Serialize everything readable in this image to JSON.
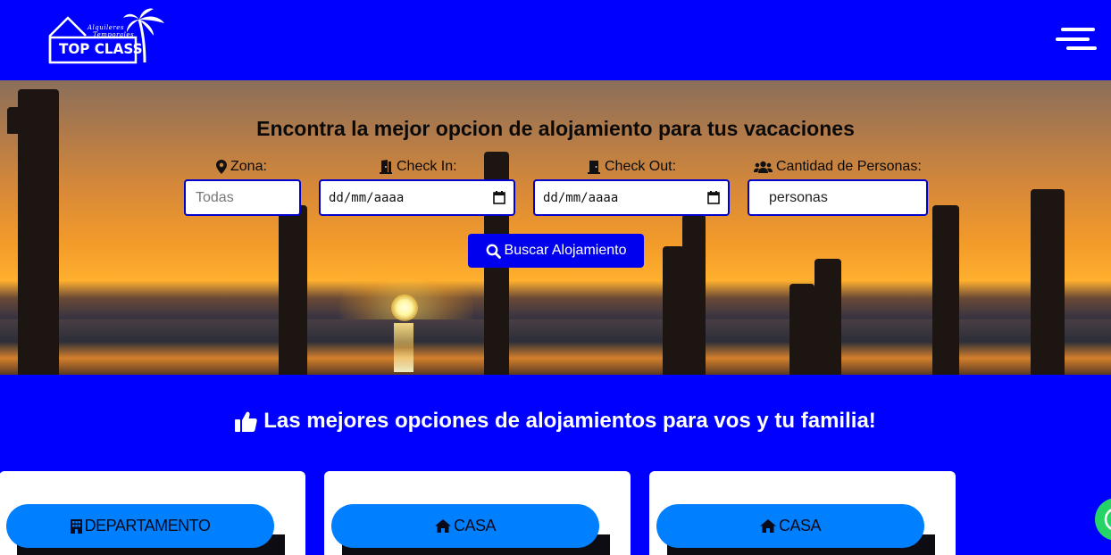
{
  "header": {
    "logo": {
      "line1": "Alquileres",
      "line2": "Temporales",
      "brand": "TOP CLASS"
    }
  },
  "search": {
    "title": "Encontra la mejor opcion de alojamiento para tus vacaciones",
    "zona_label": "Zona:",
    "zona_placeholder": "Todas",
    "checkin_label": "Check In:",
    "checkin_value": "dd/mm/aaaa",
    "checkout_label": "Check Out:",
    "checkout_value": "dd/mm/aaaa",
    "personas_label": "Cantidad de Personas:",
    "personas_value": "personas",
    "button_label": "Buscar Alojamiento"
  },
  "section": {
    "title": "Las mejores opciones de alojamientos para vos y tu familia!"
  },
  "cards": [
    {
      "type": "DEPARTAMENTO",
      "icon": "building-icon"
    },
    {
      "type": "CASA",
      "icon": "home-icon"
    },
    {
      "type": "CASA",
      "icon": "home-icon"
    }
  ],
  "colors": {
    "brand_blue": "#0000ff",
    "button_blue": "#0000ee",
    "pill_blue": "#0080ff",
    "whatsapp_green": "#25d366"
  }
}
